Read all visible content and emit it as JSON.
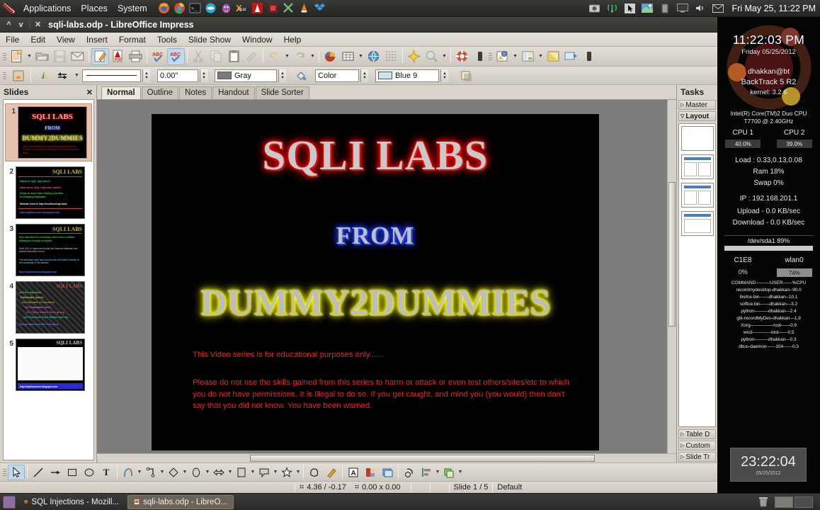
{
  "top_panel": {
    "menus": [
      "Applications",
      "Places",
      "System"
    ],
    "tray_icons": [
      "firefox-icon",
      "chrome-icon",
      "terminal-icon",
      "network-icon",
      "pidgin-icon",
      "xchat-icon",
      "acrobat-icon",
      "keepass-icon",
      "tools-icon",
      "vlc-icon",
      "dropbox-icon"
    ],
    "right_icons": [
      "camera-icon",
      "wifi-signal-icon",
      "cursor-icon",
      "display-icon",
      "battery-icon",
      "screen-icon",
      "volume-icon",
      "mail-icon"
    ],
    "clock": "Fri May 25, 11:22 PM"
  },
  "window": {
    "title": "sqli-labs.odp - LibreOffice Impress",
    "menubar": [
      "File",
      "Edit",
      "View",
      "Insert",
      "Format",
      "Tools",
      "Slide Show",
      "Window",
      "Help"
    ],
    "controls": [
      "minimize",
      "maximize",
      "close"
    ]
  },
  "toolbar_standard": {
    "items": [
      "new-document",
      "new-dropdown",
      "open-file",
      "save",
      "email-document",
      "edit-file",
      "export-pdf",
      "print",
      "spelling-check",
      "autospellcheck",
      "cut",
      "copy",
      "paste",
      "clone-formatting",
      "undo",
      "undo-dropdown",
      "redo",
      "redo-dropdown",
      "chart",
      "table",
      "table-dropdown",
      "hyperlink",
      "display-grid",
      "gallery",
      "zoom",
      "zoom-dropdown",
      "help",
      "start-slideshow",
      "slide-show-settings",
      "master-page",
      "master-dropdown",
      "display-views",
      "new-slide"
    ]
  },
  "toolbar_line_fill": {
    "items": [
      "line-style-dropdown",
      "arrow-style",
      "line-color"
    ],
    "line_width": "0.00\"",
    "line_style_value": "",
    "area_style": "Gray",
    "fill_type": "Color",
    "fill_color": "Blue 9",
    "shadow_label": "shadow-toggle"
  },
  "slides_pane": {
    "title": "Slides",
    "close_icon": "close-icon",
    "slides": [
      {
        "num": "1",
        "selected": true
      },
      {
        "num": "2",
        "selected": false
      },
      {
        "num": "3",
        "selected": false
      },
      {
        "num": "4",
        "selected": false
      },
      {
        "num": "5",
        "selected": false
      }
    ]
  },
  "view_tabs": [
    {
      "label": "Normal",
      "active": true
    },
    {
      "label": "Outline",
      "active": false
    },
    {
      "label": "Notes",
      "active": false
    },
    {
      "label": "Handout",
      "active": false
    },
    {
      "label": "Slide Sorter",
      "active": false
    }
  ],
  "slide_content": {
    "title_line1": "SQLI LABS",
    "title_line2": "FROM",
    "title_line3": "DUMMY2DUMMIES",
    "warning_line1": "This Video series is for educational purposes only......",
    "warning_body": "Please do not use the skills gained from this series to harm or attack or even test others/sites/etc  to which you do not have permissions. It is illegal to do so. If you get caught, and mind you (you would) then don't say that you did not know. You have been warned.",
    "colors": {
      "glow_red": "#ff0000",
      "glow_blue": "#1b3bff",
      "glow_yellow": "#ffff00",
      "text_fill": "#c0c0c0",
      "warning_red": "#ef2020",
      "background": "#000000"
    }
  },
  "tasks_pane": {
    "title": "Tasks",
    "sections": [
      {
        "label": "Master",
        "expanded": false
      },
      {
        "label": "Layout",
        "expanded": true
      },
      {
        "label": "Table D",
        "expanded": false
      },
      {
        "label": "Custom",
        "expanded": false
      },
      {
        "label": "Slide Tr",
        "expanded": false
      }
    ]
  },
  "statusbar": {
    "position": "4.36 / -0.17",
    "size": "0.00 x 0.00",
    "slide_info": "Slide 1 / 5",
    "master": "Default"
  },
  "drawing_toolbar": {
    "items": [
      "select-icon",
      "line-icon",
      "arrow-icon",
      "rectangle-icon",
      "ellipse-icon",
      "text-icon",
      "curve-icon",
      "connector-icon",
      "basic-shapes-icon",
      "symbol-shapes-icon",
      "block-arrows-icon",
      "flowchart-icon",
      "callouts-icon",
      "stars-icon",
      "points-icon",
      "glue-points-icon",
      "fontwork-icon",
      "from-file-icon",
      "gallery-icon",
      "rotate-icon",
      "alignment-icon",
      "arrange-icon",
      "shadow-icon"
    ]
  },
  "conky": {
    "time": "11:22:03 PM",
    "date": "Friday 05/25/2012",
    "user_host": "dhakkan@bt",
    "os": "BackTrack 5 R2",
    "kernel": "kernel: 3.2.6",
    "cpu_model_line1": "Intel(R) Core(TM)2 Duo CPU",
    "cpu_model_line2": "T7700  @ 2.40GHz",
    "cpu1_label": "CPU 1",
    "cpu2_label": "CPU 2",
    "cpu1_value": "40.0%",
    "cpu2_value": "39.0%",
    "load": "Load : 0.33,0.13,0.08",
    "ram": "Ram 18%",
    "swap": "Swap 0%",
    "ip": "IP : 192.168.201.1",
    "upload": "Upload - 0.0 KB/sec",
    "download": "Download - 0.0 KB/sec",
    "disk": "/dev/sda1 89%",
    "net1_label": "C1E8",
    "net1_value": "0%",
    "net2_label": "wlan0",
    "net2_value": "74%",
    "proc_header": "COMMAND———USER——%CPU",
    "processes": [
      "recordmydesktop-dhakkan--90.0",
      "firefox-bin——dhakkan--10.1",
      "soffice.bin——dhakkan—3.2",
      "python———dhakkan—2.4",
      "gtk-recordMyDes-dhakkan—1.9",
      "Xorg—————root——0.9",
      "wicd————root——0.5",
      "python———dhakkan—0.3",
      "dbus-daemon——104——0.3"
    ],
    "digital_clock_time": "23:22:04",
    "digital_clock_date": "05/25/2012"
  },
  "bottom_bar": {
    "show_desktop": "show-desktop-icon",
    "tasks": [
      {
        "label": "SQL Injections - Mozill...",
        "active": false,
        "icon": "firefox-icon"
      },
      {
        "label": "sqli-labs.odp - LibreO...",
        "active": true,
        "icon": "impress-icon"
      }
    ],
    "trash": "trash-icon",
    "workspaces": 2
  }
}
